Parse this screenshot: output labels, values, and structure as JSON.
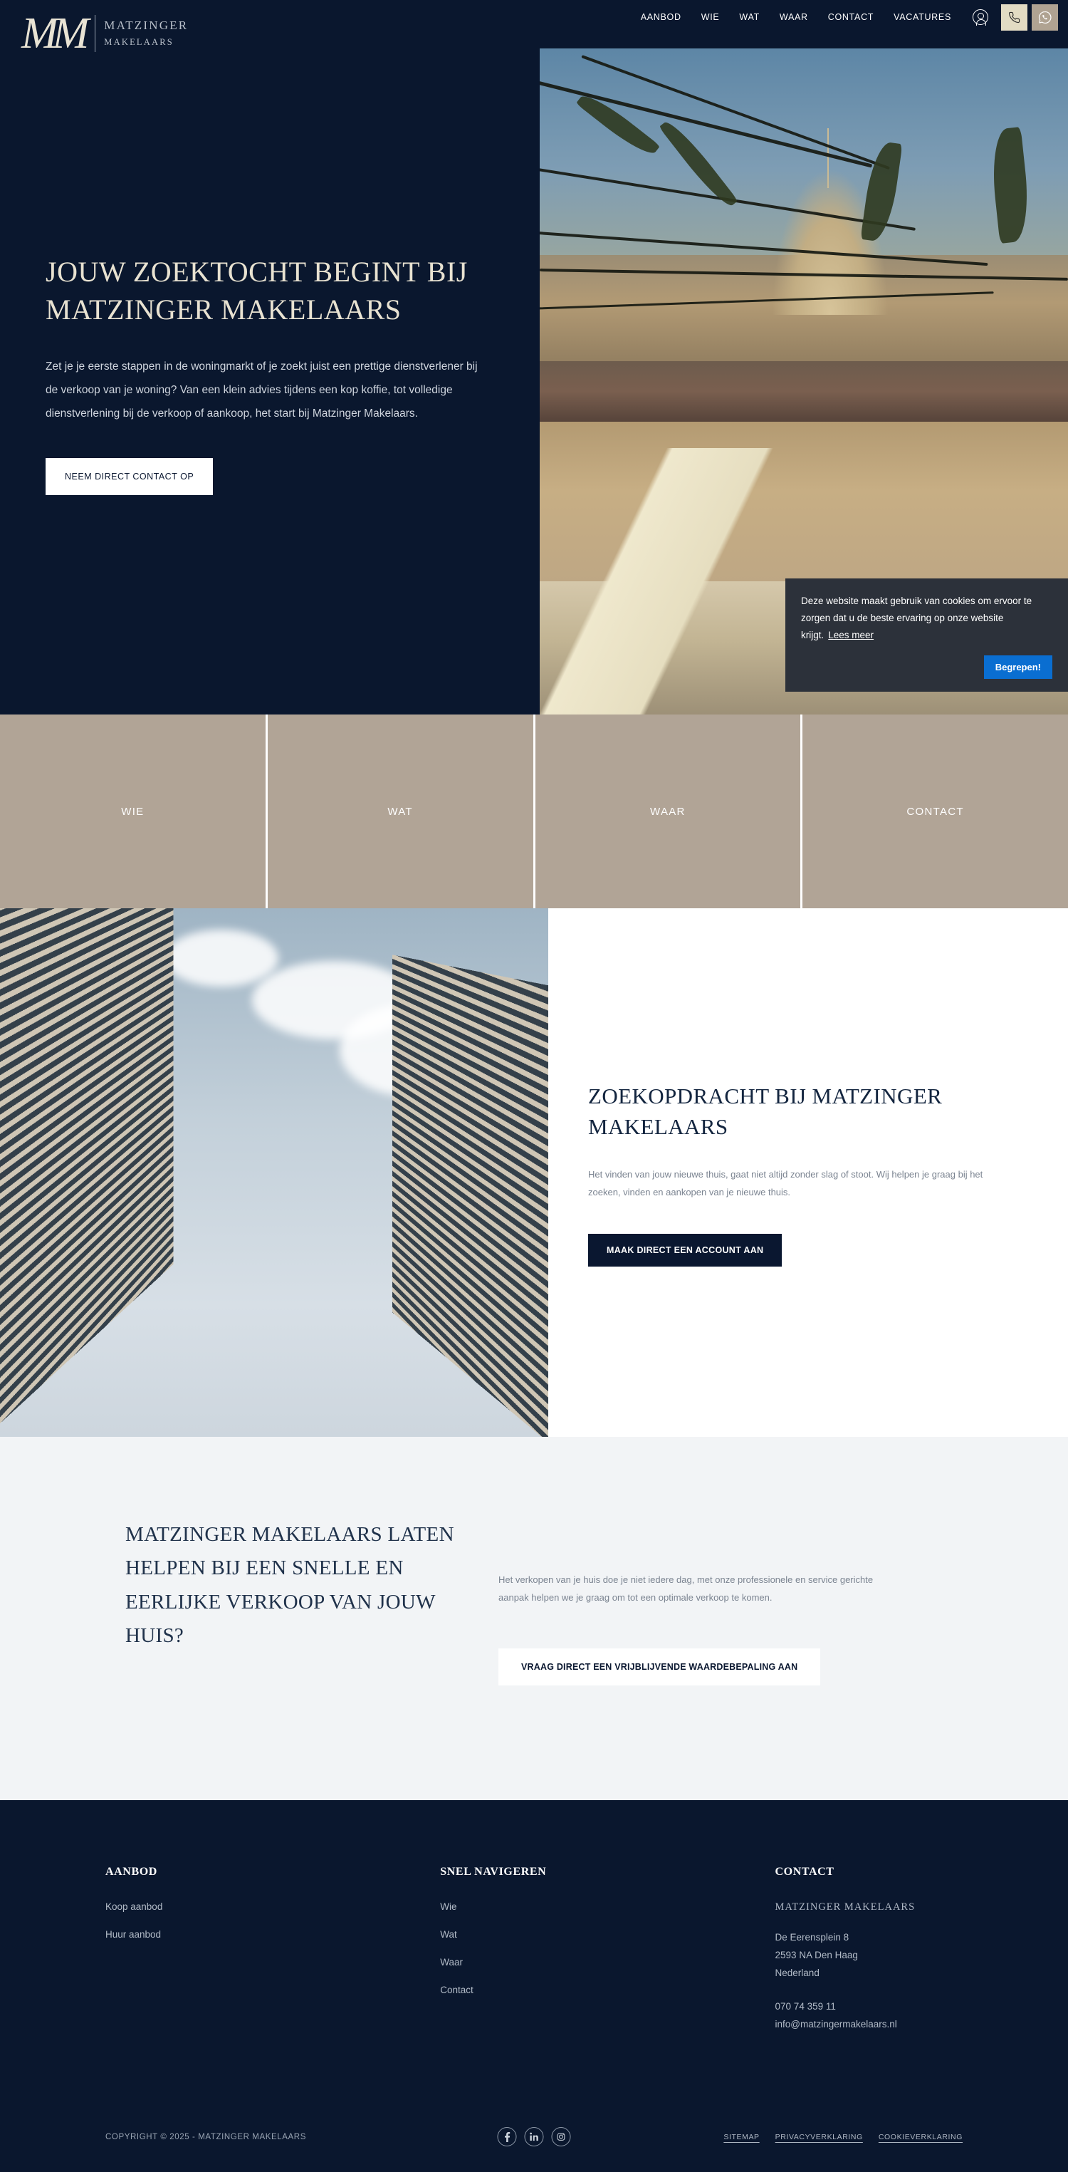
{
  "brand": {
    "monogram": "MM",
    "name_line1": "MATZINGER",
    "name_line2": "MAKELAARS",
    "navy": "#0a172e",
    "tan": "#b1a496",
    "cream": "#e2dbc3",
    "accent_blue": "#0a6ed1"
  },
  "header": {
    "nav": [
      {
        "label": "AANBOD"
      },
      {
        "label": "WIE"
      },
      {
        "label": "WAT"
      },
      {
        "label": "WAAR"
      },
      {
        "label": "CONTACT"
      },
      {
        "label": "VACATURES"
      }
    ],
    "account_icon": "user-circle-icon",
    "phone_icon": "phone-icon",
    "whatsapp_icon": "whatsapp-icon"
  },
  "hero": {
    "title": "JOUW ZOEKTOCHT BEGINT BIJ MATZINGER MAKELAARS",
    "subtitle": "Zet je je eerste stappen in de woningmarkt of je zoekt juist een prettige dienstverlener bij de verkoop van je woning? Van een klein advies tijdens een kop koffie, tot volledige dienstverlening bij de verkoop of aankoop, het start bij Matzinger Makelaars.",
    "cta": "NEEM DIRECT CONTACT OP"
  },
  "cookie": {
    "text": "Deze website maakt gebruik van cookies om ervoor te zorgen dat u de beste ervaring op onze website krijgt.",
    "link": "Lees meer",
    "button": "Begrepen!"
  },
  "tiles": [
    {
      "label": "WIE"
    },
    {
      "label": "WAT"
    },
    {
      "label": "WAAR"
    },
    {
      "label": "CONTACT"
    }
  ],
  "zoekopdracht": {
    "title": "ZOEKOPDRACHT BIJ MATZINGER MAKELAARS",
    "body": "Het vinden van jouw nieuwe thuis, gaat niet altijd zonder slag of stoot. Wij helpen je graag bij het zoeken, vinden en aankopen van je nieuwe thuis.",
    "cta": "MAAK DIRECT EEN ACCOUNT AAN"
  },
  "verkoop": {
    "title": "MATZINGER MAKELAARS LATEN HELPEN BIJ EEN SNELLE EN EERLIJKE VERKOOP VAN JOUW HUIS?",
    "body": "Het verkopen van je huis doe je niet iedere dag, met onze professionele en service gerichte aanpak helpen we je graag om tot een optimale verkoop te komen.",
    "cta": "VRAAG DIRECT EEN VRIJBLIJVENDE WAARDEBEPALING AAN"
  },
  "footer": {
    "col1": {
      "heading": "AANBOD",
      "links": [
        {
          "label": "Koop aanbod"
        },
        {
          "label": "Huur aanbod"
        }
      ]
    },
    "col2": {
      "heading": "SNEL NAVIGEREN",
      "links": [
        {
          "label": "Wie"
        },
        {
          "label": "Wat"
        },
        {
          "label": "Waar"
        },
        {
          "label": "Contact"
        }
      ]
    },
    "col3": {
      "heading": "CONTACT",
      "company": "MATZINGER MAKELAARS",
      "address_line1": "De Eerensplein 8",
      "address_line2": "2593 NA Den Haag",
      "address_line3": "Nederland",
      "phone": "070 74 359 11",
      "email": "info@matzingermakelaars.nl"
    },
    "copyright": "COPYRIGHT © 2025 - MATZINGER MAKELAARS",
    "socials": [
      {
        "name": "facebook-icon",
        "glyph": "f"
      },
      {
        "name": "linkedin-icon",
        "glyph": "in"
      },
      {
        "name": "instagram-icon",
        "glyph": "◉"
      }
    ],
    "legal": [
      {
        "label": "SITEMAP"
      },
      {
        "label": "PRIVACYVERKLARING"
      },
      {
        "label": "COOKIEVERKLARING"
      }
    ]
  }
}
